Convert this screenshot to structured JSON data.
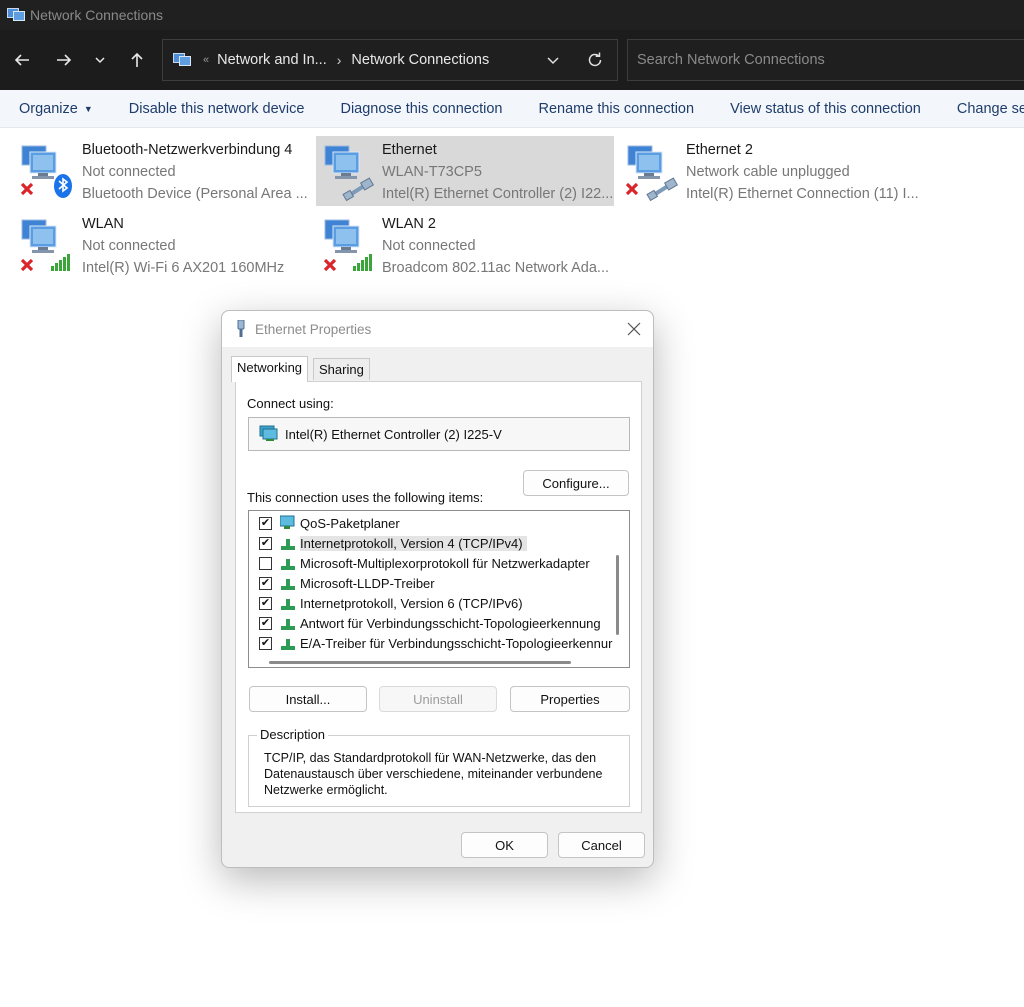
{
  "window": {
    "title": "Network Connections"
  },
  "nav": {
    "back_icon": "back-arrow-icon",
    "forward_icon": "forward-arrow-icon",
    "up_icon": "up-arrow-icon",
    "breadcrumb": [
      "Network and In...",
      "Network Connections"
    ],
    "search_placeholder": "Search Network Connections"
  },
  "toolbar": {
    "items": [
      "Organize",
      "Disable this network device",
      "Diagnose this connection",
      "Rename this connection",
      "View status of this connection",
      "Change settin"
    ]
  },
  "connections": [
    {
      "name": "Bluetooth-Netzwerkverbindung 4",
      "status": "Not connected",
      "device": "Bluetooth Device (Personal Area ...",
      "type": "bluetooth",
      "error": true,
      "selected": false
    },
    {
      "name": "Ethernet",
      "status": "WLAN-T73CP5",
      "device": "Intel(R) Ethernet Controller (2) I22...",
      "type": "ethernet",
      "error": false,
      "selected": true
    },
    {
      "name": "Ethernet 2",
      "status": "Network cable unplugged",
      "device": "Intel(R) Ethernet Connection (11) I...",
      "type": "ethernet",
      "error": true,
      "selected": false
    },
    {
      "name": "WLAN",
      "status": "Not connected",
      "device": "Intel(R) Wi-Fi 6 AX201 160MHz",
      "type": "wifi",
      "error": true,
      "selected": false
    },
    {
      "name": "WLAN 2",
      "status": "Not connected",
      "device": "Broadcom 802.11ac Network Ada...",
      "type": "wifi",
      "error": true,
      "selected": false
    }
  ],
  "dialog": {
    "title": "Ethernet Properties",
    "tabs": [
      "Networking",
      "Sharing"
    ],
    "connect_using_label": "Connect using:",
    "adapter": "Intel(R) Ethernet Controller (2) I225-V",
    "configure_button": "Configure...",
    "items_label": "This connection uses the following items:",
    "items": [
      {
        "label": "QoS-Paketplaner",
        "checked": true,
        "icon": "qos-icon"
      },
      {
        "label": "Internetprotokoll, Version 4 (TCP/IPv4)",
        "checked": true,
        "icon": "protocol-icon",
        "highlight": true
      },
      {
        "label": "Microsoft-Multiplexorprotokoll für Netzwerkadapter",
        "checked": false,
        "icon": "protocol-icon"
      },
      {
        "label": "Microsoft-LLDP-Treiber",
        "checked": true,
        "icon": "protocol-icon"
      },
      {
        "label": "Internetprotokoll, Version 6 (TCP/IPv6)",
        "checked": true,
        "icon": "protocol-icon"
      },
      {
        "label": "Antwort für Verbindungsschicht-Topologieerkennung",
        "checked": true,
        "icon": "protocol-icon"
      },
      {
        "label": "E/A-Treiber für Verbindungsschicht-Topologieerkennur",
        "checked": true,
        "icon": "protocol-icon"
      }
    ],
    "install_button": "Install...",
    "uninstall_button": "Uninstall",
    "properties_button": "Properties",
    "description_label": "Description",
    "description_text": "TCP/IP, das Standardprotokoll für WAN-Netzwerke, das den Datenaustausch über verschiedene, miteinander verbundene Netzwerke ermöglicht.",
    "ok_button": "OK",
    "cancel_button": "Cancel"
  },
  "colors": {
    "titlebar_bg": "#202020",
    "navbar_bg": "#1c1c1c",
    "command_text": "#1f3d6b",
    "selection": "#d9d9d9",
    "error_red": "#d9262c",
    "signal_green": "#3aa63a",
    "bluetooth_blue": "#1a73e8"
  }
}
